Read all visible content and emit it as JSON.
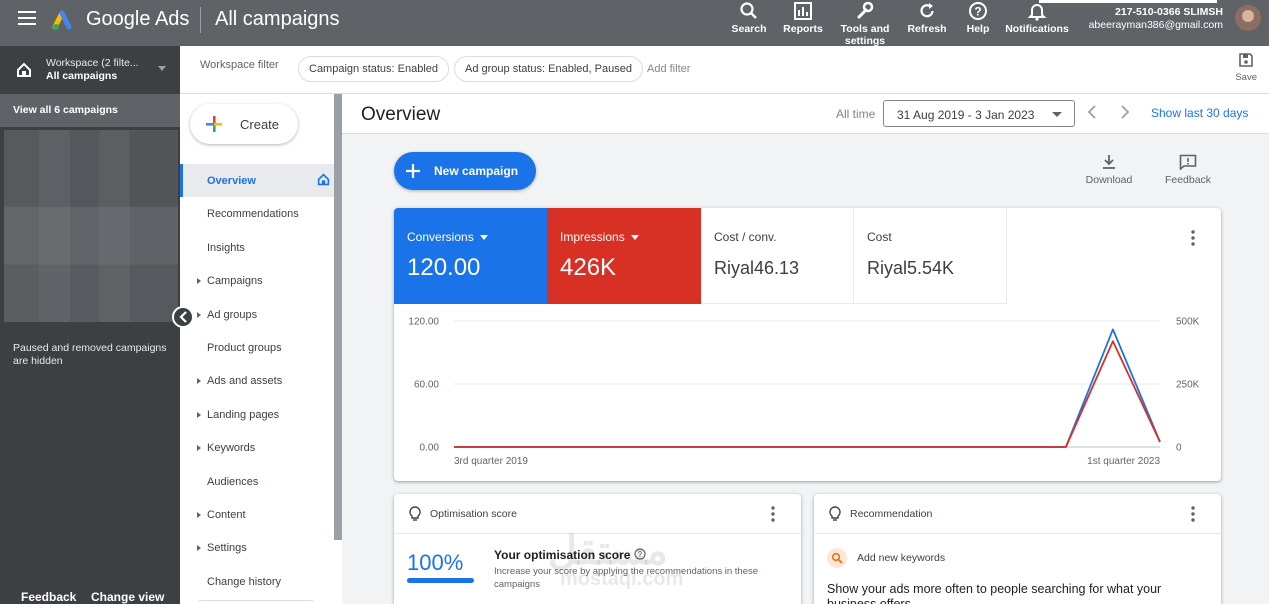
{
  "header": {
    "product": "Google Ads",
    "page": "All campaigns",
    "tools": [
      {
        "label": "Search",
        "icon": "search-icon"
      },
      {
        "label": "Reports",
        "icon": "reports-icon"
      },
      {
        "label": "Tools and settings",
        "icon": "wrench-icon"
      },
      {
        "label": "Refresh",
        "icon": "refresh-icon"
      },
      {
        "label": "Help",
        "icon": "help-icon"
      },
      {
        "label": "Notifications",
        "icon": "bell-icon"
      }
    ],
    "account_id": "217-510-0366 SLIMSH",
    "account_email": "abeerayman386@gmail.com"
  },
  "left_panel": {
    "workspace_label": "Workspace (2 filte...",
    "workspace_sub": "All campaigns",
    "view_all": "View all 6 campaigns",
    "hidden_note": "Paused and removed campaigns are hidden",
    "feedback": "Feedback",
    "change_view": "Change view"
  },
  "filters": {
    "workspace_filter": "Workspace filter",
    "chips": [
      "Campaign status: Enabled",
      "Ad group status: Enabled, Paused"
    ],
    "add_filter": "Add filter",
    "save": "Save"
  },
  "nav": {
    "create": "Create",
    "items": [
      {
        "label": "Overview",
        "expandable": false,
        "active": true
      },
      {
        "label": "Recommendations",
        "expandable": false
      },
      {
        "label": "Insights",
        "expandable": false
      },
      {
        "label": "Campaigns",
        "expandable": true
      },
      {
        "label": "Ad groups",
        "expandable": true
      },
      {
        "label": "Product groups",
        "expandable": false
      },
      {
        "label": "Ads and assets",
        "expandable": true
      },
      {
        "label": "Landing pages",
        "expandable": true
      },
      {
        "label": "Keywords",
        "expandable": true
      },
      {
        "label": "Audiences",
        "expandable": false
      },
      {
        "label": "Content",
        "expandable": true
      },
      {
        "label": "Settings",
        "expandable": true
      },
      {
        "label": "Change history",
        "expandable": false
      }
    ]
  },
  "overview": {
    "title": "Overview",
    "all_time": "All time",
    "date_range": "31 Aug 2019 - 3 Jan 2023",
    "show_last": "Show last 30 days",
    "new_campaign": "New campaign",
    "download": "Download",
    "feedback": "Feedback"
  },
  "metrics": [
    {
      "label": "Conversions",
      "value": "120.00",
      "color": "#1a73e8"
    },
    {
      "label": "Impressions",
      "value": "426K",
      "color": "#d93025"
    },
    {
      "label": "Cost / conv.",
      "value": "Riyal46.13"
    },
    {
      "label": "Cost",
      "value": "Riyal5.54K"
    }
  ],
  "chart_data": {
    "type": "line",
    "x_labels": [
      "3rd quarter 2019",
      "1st quarter 2023"
    ],
    "left_axis": {
      "ticks": [
        "120.00",
        "60.00",
        "0.00"
      ],
      "max": 120
    },
    "right_axis": {
      "ticks": [
        "500K",
        "250K",
        "0"
      ],
      "max": 500000
    },
    "series": [
      {
        "name": "Conversions",
        "color": "#1a73e8",
        "axis": "left",
        "values": [
          0,
          0,
          0,
          0,
          0,
          0,
          0,
          0,
          0,
          0,
          0,
          0,
          0,
          0,
          112,
          5
        ]
      },
      {
        "name": "Impressions",
        "color": "#d93025",
        "axis": "right",
        "values": [
          0,
          0,
          0,
          0,
          0,
          0,
          0,
          0,
          0,
          0,
          0,
          0,
          0,
          0,
          420000,
          20000
        ]
      }
    ],
    "grid": true
  },
  "optimisation": {
    "title": "Optimisation score",
    "score": "100%",
    "heading": "Your optimisation score",
    "desc": "Increase your score by applying the recommendations in these campaigns"
  },
  "recommendation": {
    "title": "Recommendation",
    "add": "Add new keywords",
    "body": "Show your ads more often to people searching for what your business offers"
  },
  "watermark": {
    "arabic": "مستقل",
    "latin": "mostaql.com"
  }
}
